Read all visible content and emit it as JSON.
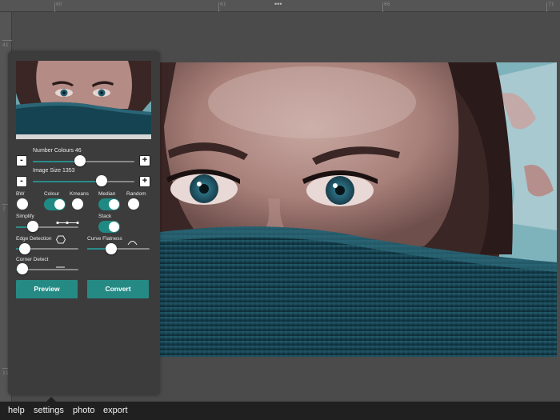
{
  "ruler": {
    "top_labels": [
      "60",
      "61",
      "66",
      "71"
    ],
    "left_labels": [
      "41",
      "7",
      "11"
    ]
  },
  "panel": {
    "number_colours": {
      "label": "Number Colours 46",
      "value": 46,
      "minus": "-",
      "plus": "+"
    },
    "image_size": {
      "label": "Image Size 1353",
      "value": 1353,
      "minus": "-",
      "plus": "+"
    },
    "options": {
      "bw": {
        "label": "BW",
        "on": false
      },
      "colour": {
        "label": "Colour",
        "on": true
      },
      "kmeans": {
        "label": "Kmeans",
        "on": false
      },
      "median": {
        "label": "Median",
        "on": true
      },
      "random": {
        "label": "Random",
        "on": false
      }
    },
    "simplify": {
      "label": "Simplify"
    },
    "stack": {
      "label": "Stack",
      "on": true
    },
    "edge_detection": {
      "label": "Edge Detection"
    },
    "curve_flatness": {
      "label": "Curve Flatness"
    },
    "corner_detect": {
      "label": "Corner Detect"
    },
    "preview_label": "Preview",
    "convert_label": "Convert"
  },
  "nav": {
    "help": "help",
    "settings": "settings",
    "photo": "photo",
    "export": "export",
    "active": "settings"
  },
  "colors": {
    "accent": "#258a84",
    "panel": "#3c3c3c",
    "bar": "#202020"
  }
}
